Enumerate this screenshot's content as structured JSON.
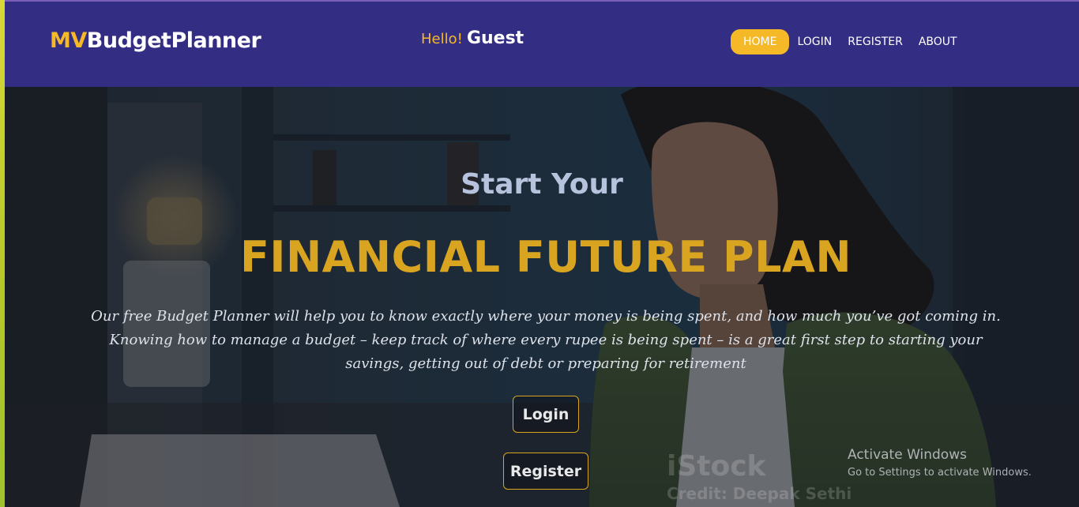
{
  "header": {
    "brand_prefix": "MV",
    "brand_suffix": "BudgetPlanner",
    "greeting_hello": "Hello!",
    "greeting_user": "Guest",
    "nav": [
      {
        "label": "HOME",
        "active": true
      },
      {
        "label": "LOGIN",
        "active": false
      },
      {
        "label": "REGISTER",
        "active": false
      },
      {
        "label": "ABOUT",
        "active": false
      }
    ]
  },
  "hero": {
    "subtitle": "Start Your",
    "title": "FINANCIAL FUTURE PLAN",
    "description": "Our free Budget Planner will help you to know exactly where your money is being spent, and how much you’ve got coming in. Knowing how to manage a budget – keep track of where every rupee is being spent – is a great first step to starting your savings, getting out of debt or preparing for retirement",
    "login_button": "Login",
    "register_button": "Register"
  },
  "watermark": {
    "logo": "iStock",
    "credit": "Credit: Deepak Sethi"
  },
  "os_overlay": {
    "title": "Activate Windows",
    "subtitle": "Go to Settings to activate Windows."
  },
  "colors": {
    "navbar_bg": "#332d84",
    "accent_yellow": "#f5b928",
    "title_gold": "#d9a521"
  }
}
